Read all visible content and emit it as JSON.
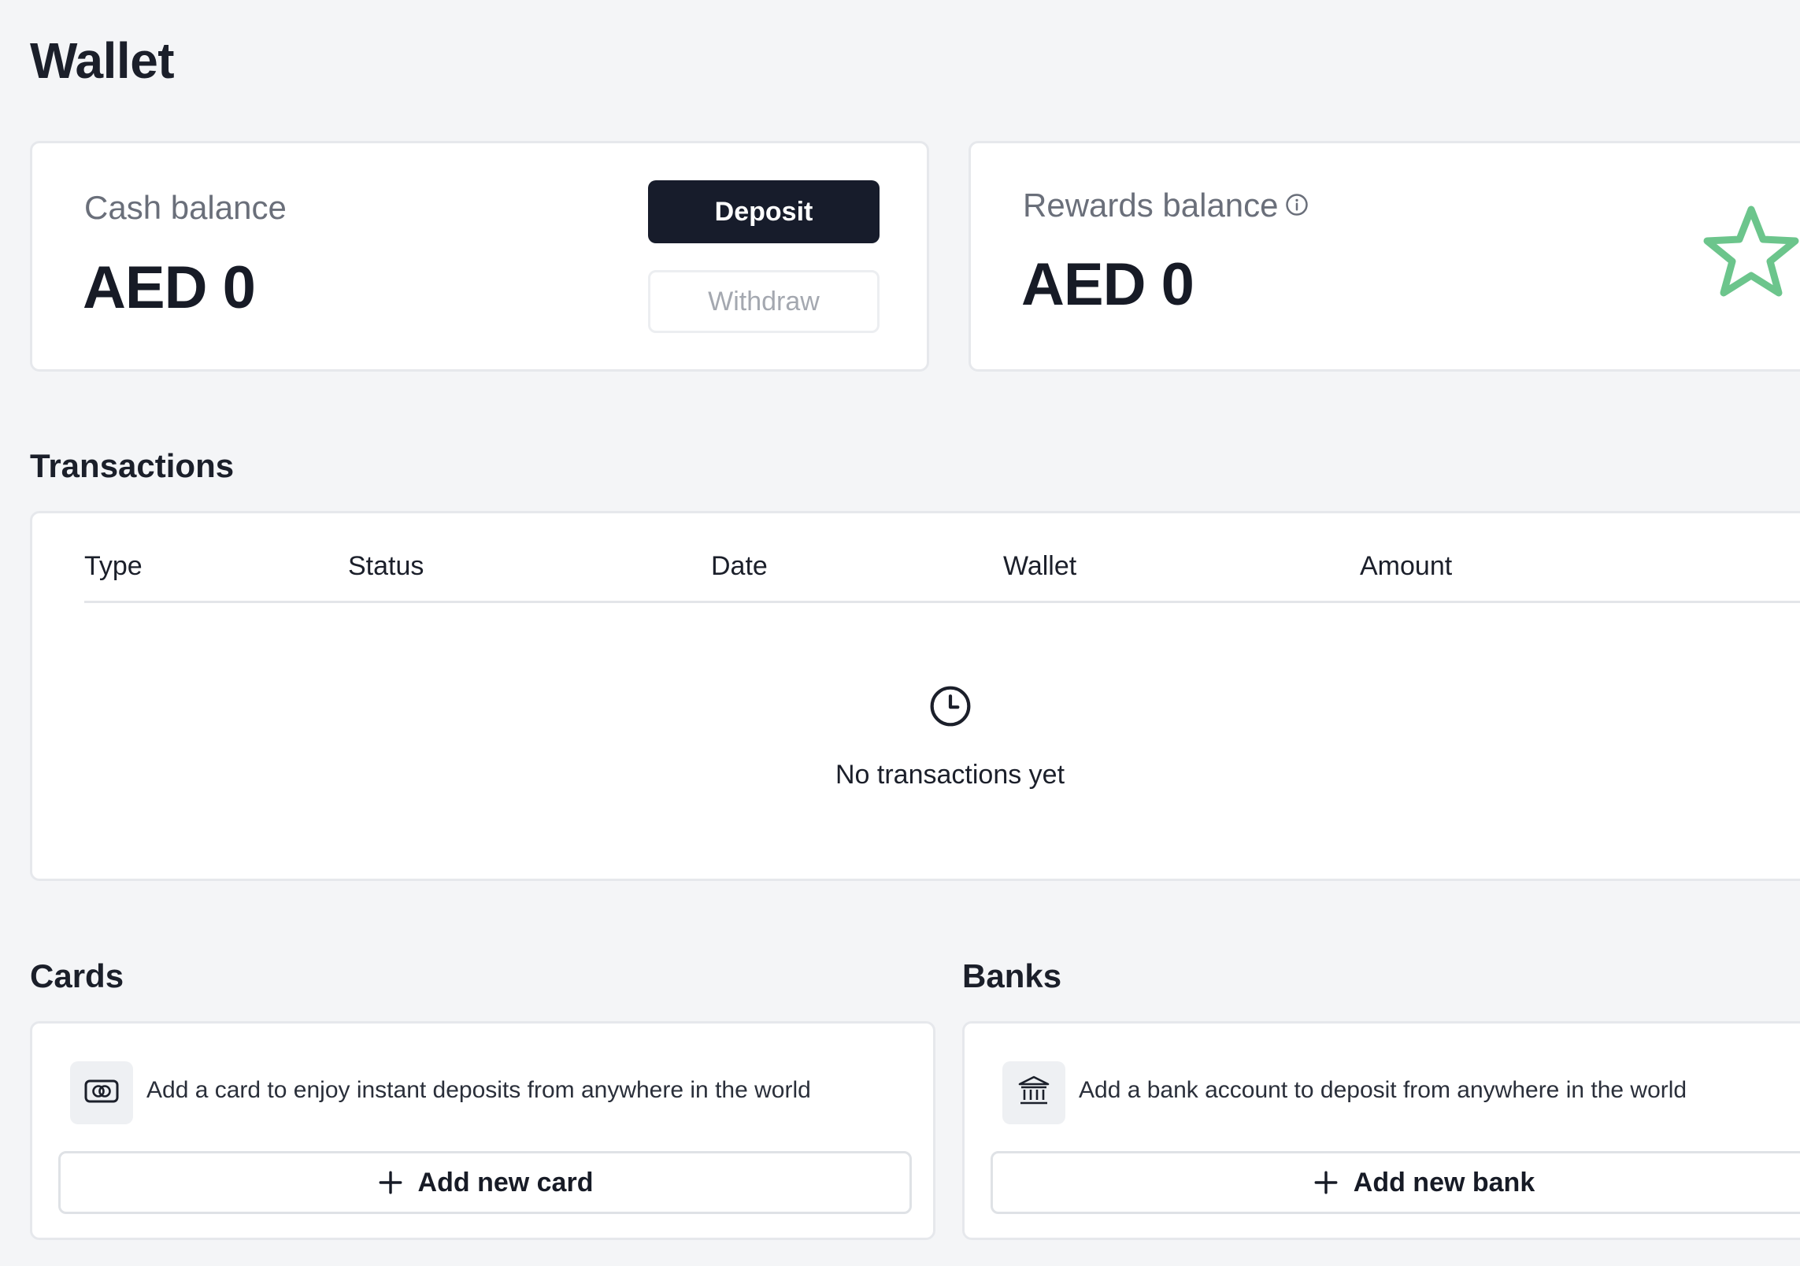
{
  "page": {
    "title": "Wallet"
  },
  "cash": {
    "label": "Cash balance",
    "amount": "AED 0",
    "deposit_label": "Deposit",
    "withdraw_label": "Withdraw"
  },
  "rewards": {
    "label": "Rewards balance",
    "amount": "AED 0",
    "accent_color": "#6cc58c"
  },
  "transactions": {
    "title": "Transactions",
    "columns": [
      "Type",
      "Status",
      "Date",
      "Wallet",
      "Amount"
    ],
    "empty_text": "No transactions yet"
  },
  "cards": {
    "title": "Cards",
    "description": "Add a card to enjoy instant deposits from anywhere in the world",
    "add_label": "Add new card"
  },
  "banks": {
    "title": "Banks",
    "description": "Add a bank account to deposit from anywhere in the world",
    "add_label": "Add new bank"
  }
}
